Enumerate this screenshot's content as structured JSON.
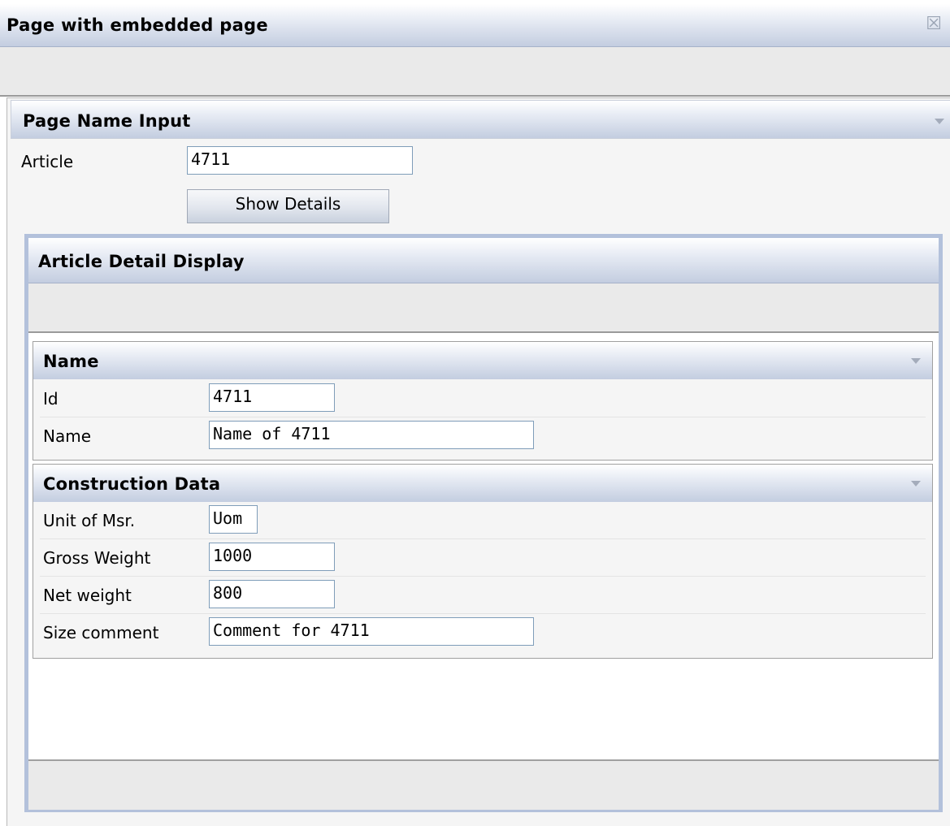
{
  "window": {
    "title": "Page with embedded page"
  },
  "page_name_input": {
    "title": "Page Name Input",
    "article_label": "Article",
    "article_value": "4711",
    "show_details_label": "Show Details"
  },
  "embedded": {
    "title": "Article Detail Display",
    "name_section": {
      "title": "Name",
      "id_label": "Id",
      "id_value": "4711",
      "name_label": "Name",
      "name_value": "Name of 4711"
    },
    "construction_section": {
      "title": "Construction Data",
      "uom_label": "Unit of Msr.",
      "uom_value": "Uom",
      "gross_label": "Gross Weight",
      "gross_value": "1000",
      "net_label": "Net weight",
      "net_value": "800",
      "size_label": "Size comment",
      "size_value": "Comment for 4711"
    }
  },
  "icons": {
    "close": "close-icon",
    "collapse": "chevron-down-icon"
  },
  "colors": {
    "frame_border": "#b3c1db",
    "field_border": "#7f9db9"
  }
}
